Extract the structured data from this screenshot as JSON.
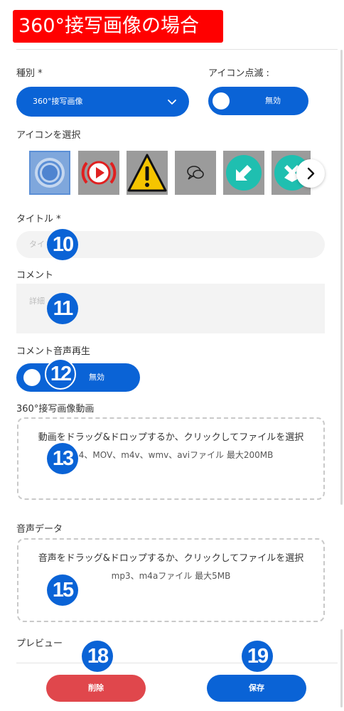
{
  "banner": {
    "title": "360°接写画像の場合"
  },
  "form": {
    "type": {
      "label": "種別 *",
      "value": "360°接写画像"
    },
    "blink": {
      "label": "アイコン点滅 :",
      "state": "無効"
    },
    "icon_select": {
      "label": "アイコンを選択",
      "icons": [
        "ring-target-icon",
        "play-button-icon",
        "warning-icon",
        "speech-bubbles-icon",
        "arrow-down-left-icon",
        "arrow-down-icon"
      ],
      "next_icon": "chevron-right-icon"
    },
    "title": {
      "label": "タイトル *",
      "placeholder": "タイ"
    },
    "comment": {
      "label": "コメント",
      "placeholder": "詳細"
    },
    "comment_audio": {
      "label": "コメント音声再生",
      "state": "無効"
    },
    "video": {
      "label": "360°接写画像動画",
      "drop_text": "動画をドラッグ&ドロップするか、クリックしてファイルを選択",
      "formats": "M  4、MOV、m4v、wmv、aviファイル 最大200MB"
    },
    "audio": {
      "label": "音声データ",
      "drop_text": "音声をドラッグ&ドロップするか、クリックしてファイルを選択",
      "formats": "mp3、m4aファイル 最大5MB"
    },
    "preview": {
      "label": "プレビュー"
    }
  },
  "actions": {
    "delete_label": "削除",
    "save_label": "保存"
  },
  "callouts": [
    "10",
    "11",
    "12",
    "13",
    "15",
    "18",
    "19"
  ],
  "colors": {
    "accent": "#0a63d6",
    "danger": "#e0474c",
    "banner": "#ff0000"
  }
}
